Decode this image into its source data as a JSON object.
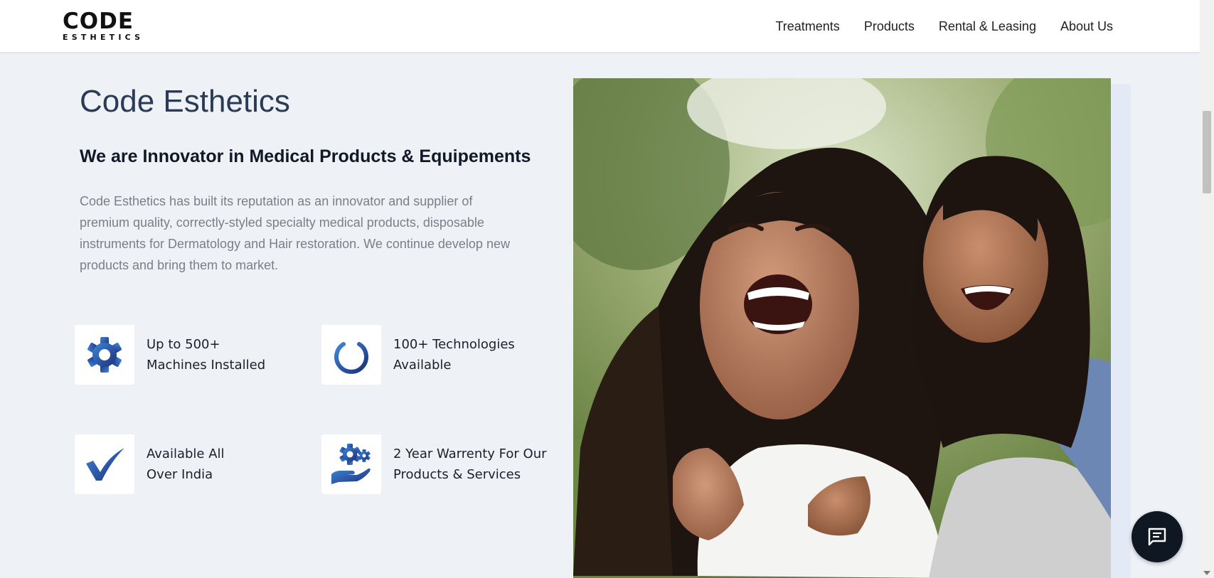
{
  "header": {
    "logo_main": "CODE",
    "logo_sub": "ESTHETICS",
    "nav": [
      "Treatments",
      "Products",
      "Rental & Leasing",
      "About Us"
    ]
  },
  "main": {
    "title": "Code Esthetics",
    "subtitle": "We are Innovator in Medical Products & Equipements",
    "description": "Code Esthetics has built its reputation as an innovator and supplier of premium quality, correctly-styled specialty medical products, disposable instruments for Dermatology and Hair restoration. We continue develop new products and bring them to market.",
    "features": [
      {
        "line1": "Up to 500+",
        "line2": "Machines Installed",
        "icon": "gear-icon"
      },
      {
        "line1": "100+ Technologies",
        "line2": "Available",
        "icon": "power-icon"
      },
      {
        "line1": "Available All",
        "line2": "Over India",
        "icon": "checkmark-icon"
      },
      {
        "line1": "2 Year Warrenty For Our",
        "line2": "Products & Services",
        "icon": "hand-gears-icon"
      }
    ]
  },
  "colors": {
    "background": "#eef2f7",
    "title": "#2b3a55",
    "icon_gradient_start": "#3a7bd5",
    "icon_gradient_end": "#1b2f7a",
    "chat_button": "#0f1722"
  }
}
